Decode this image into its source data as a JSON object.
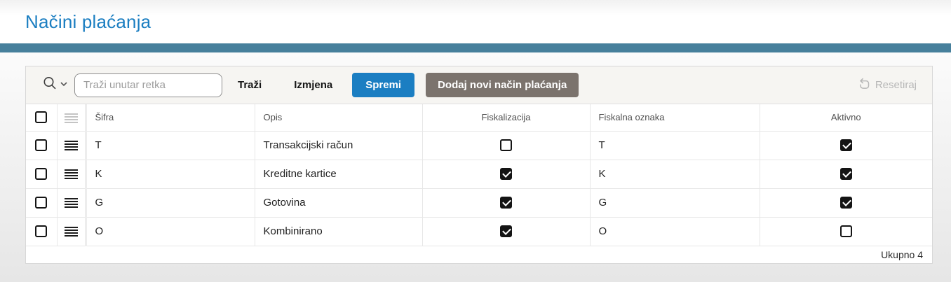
{
  "page": {
    "title": "Načini plaćanja"
  },
  "toolbar": {
    "search_placeholder": "Traži unutar retka",
    "search_label": "Traži",
    "edit_label": "Izmjena",
    "save_label": "Spremi",
    "add_label": "Dodaj novi način plaćanja",
    "reset_label": "Resetiraj"
  },
  "table": {
    "columns": [
      "Šifra",
      "Opis",
      "Fiskalizacija",
      "Fiskalna oznaka",
      "Aktivno"
    ],
    "rows": [
      {
        "sifra": "T",
        "opis": "Transakcijski račun",
        "fiskalizacija": false,
        "fiskalna_oznaka": "T",
        "aktivno": true
      },
      {
        "sifra": "K",
        "opis": "Kreditne kartice",
        "fiskalizacija": true,
        "fiskalna_oznaka": "K",
        "aktivno": true
      },
      {
        "sifra": "G",
        "opis": "Gotovina",
        "fiskalizacija": true,
        "fiskalna_oznaka": "G",
        "aktivno": true
      },
      {
        "sifra": "O",
        "opis": "Kombinirano",
        "fiskalizacija": true,
        "fiskalna_oznaka": "O",
        "aktivno": false
      }
    ],
    "footer_total": "Ukupno 4"
  },
  "colors": {
    "title_blue": "#1b7ec1",
    "teal_bar": "#47809c",
    "save_button_blue": "#1b7ec2",
    "add_button_gray": "#7b736d",
    "toolbar_background": "#f6f5f2",
    "checkbox_black": "#141414"
  }
}
